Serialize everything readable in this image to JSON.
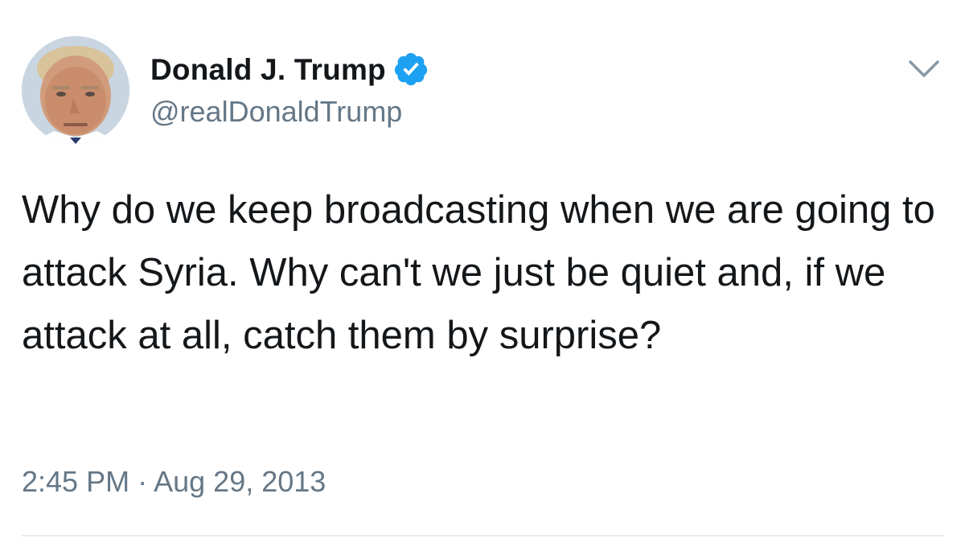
{
  "tweet": {
    "user_name": "Donald J. Trump",
    "handle": "@realDonaldTrump",
    "text": "Why do we keep broadcasting when we are going to attack Syria. Why can't we just be quiet and, if we attack at all, catch them by surprise?",
    "time": "2:45 PM",
    "separator": "·",
    "date": "Aug 29, 2013"
  },
  "icons": {
    "verified": "verified-badge-icon",
    "caret": "chevron-down-icon"
  },
  "colors": {
    "verified_blue": "#1da1f2",
    "text": "#14171a",
    "secondary_text": "#657786",
    "divider": "#e6ecf0"
  }
}
